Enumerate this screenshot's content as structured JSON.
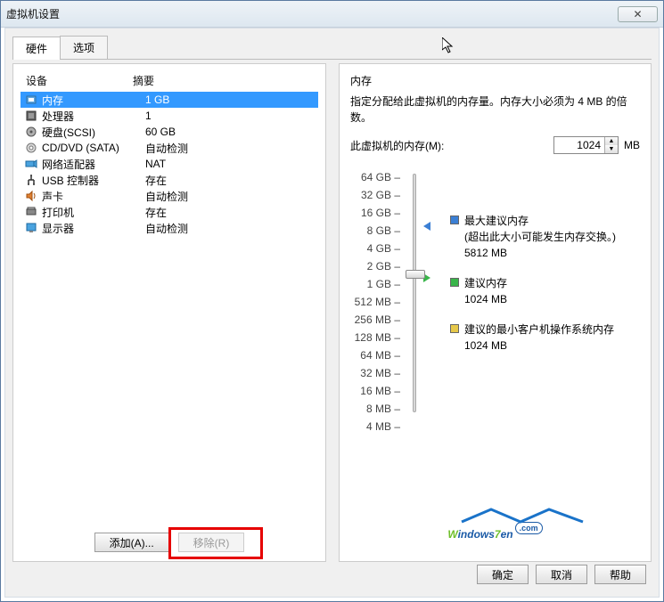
{
  "window": {
    "title": "虚拟机设置",
    "close": "✕"
  },
  "tabs": {
    "hardware": "硬件",
    "options": "选项"
  },
  "hardware": {
    "headers": {
      "device": "设备",
      "summary": "摘要"
    },
    "items": [
      {
        "label": "内存",
        "summary": "1 GB",
        "selected": true
      },
      {
        "label": "处理器",
        "summary": "1"
      },
      {
        "label": "硬盘(SCSI)",
        "summary": "60 GB"
      },
      {
        "label": "CD/DVD (SATA)",
        "summary": "自动检测"
      },
      {
        "label": "网络适配器",
        "summary": "NAT"
      },
      {
        "label": "USB 控制器",
        "summary": "存在"
      },
      {
        "label": "声卡",
        "summary": "自动检测"
      },
      {
        "label": "打印机",
        "summary": "存在"
      },
      {
        "label": "显示器",
        "summary": "自动检测"
      }
    ],
    "add_btn": "添加(A)...",
    "remove_btn": "移除(R)"
  },
  "memory": {
    "title": "内存",
    "description": "指定分配给此虚拟机的内存量。内存大小必须为 4 MB 的倍数。",
    "field_label": "此虚拟机的内存(M):",
    "value": "1024",
    "unit": "MB",
    "ticks": [
      "64 GB",
      "32 GB",
      "16 GB",
      "8 GB",
      "4 GB",
      "2 GB",
      "1 GB",
      "512 MB",
      "256 MB",
      "128 MB",
      "64 MB",
      "32 MB",
      "16 MB",
      "8 MB",
      "4 MB"
    ],
    "legend": {
      "max": {
        "label": "最大建议内存",
        "note": "(超出此大小可能发生内存交换。)",
        "value": "5812 MB",
        "color": "#3b7fd4"
      },
      "rec": {
        "label": "建议内存",
        "value": "1024 MB",
        "color": "#39b54a"
      },
      "min": {
        "label": "建议的最小客户机操作系统内存",
        "value": "1024 MB",
        "color": "#e6c84a"
      }
    }
  },
  "footer": {
    "ok": "确定",
    "cancel": "取消",
    "help": "帮助"
  },
  "logo": {
    "text_w": "W",
    "text_indows": "indows",
    "text_7": "7",
    "text_en": "en",
    "dot_com": ".com"
  }
}
